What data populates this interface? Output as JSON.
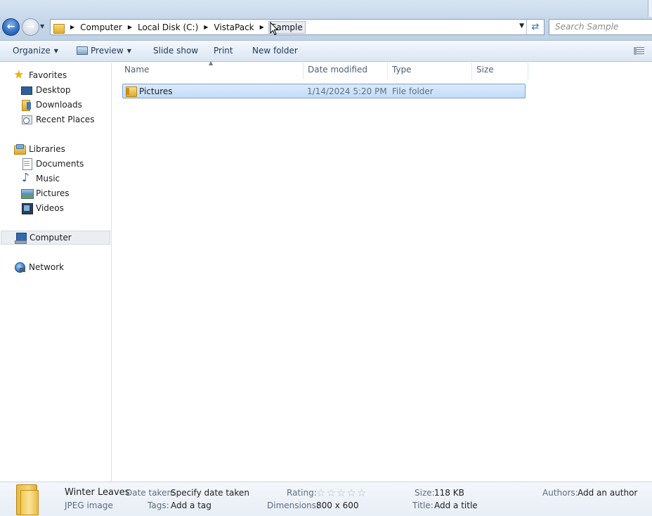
{
  "address_bar": {
    "crumbs": [
      "Computer",
      "Local Disk (C:)",
      "VistaPack",
      "Sample"
    ],
    "search_placeholder": "Search Sample"
  },
  "toolbar": {
    "organize": "Organize",
    "preview": "Preview",
    "slideshow": "Slide show",
    "print": "Print",
    "new_folder": "New folder"
  },
  "nav": {
    "favorites": "Favorites",
    "desktop": "Desktop",
    "downloads": "Downloads",
    "recent_places": "Recent Places",
    "libraries": "Libraries",
    "documents": "Documents",
    "music": "Music",
    "pictures": "Pictures",
    "videos": "Videos",
    "computer": "Computer",
    "network": "Network"
  },
  "columns": {
    "name": "Name",
    "date_modified": "Date modified",
    "type": "Type",
    "size": "Size"
  },
  "files": [
    {
      "name": "Pictures",
      "date_modified": "1/14/2024 5:20 PM",
      "type": "File folder",
      "size": ""
    }
  ],
  "details": {
    "name": "Winter Leaves",
    "kind": "JPEG image",
    "date_taken_label": "Date taken:",
    "date_taken_value": "Specify date taken",
    "tags_label": "Tags:",
    "tags_value": "Add a tag",
    "rating_label": "Rating:",
    "rating_value": 0,
    "rating_max": 5,
    "dimensions_label": "Dimensions:",
    "dimensions_value": "800 x 600",
    "size_label": "Size:",
    "size_value": "118 KB",
    "title_label": "Title:",
    "title_value": "Add a title",
    "authors_label": "Authors:",
    "authors_value": "Add an author"
  }
}
